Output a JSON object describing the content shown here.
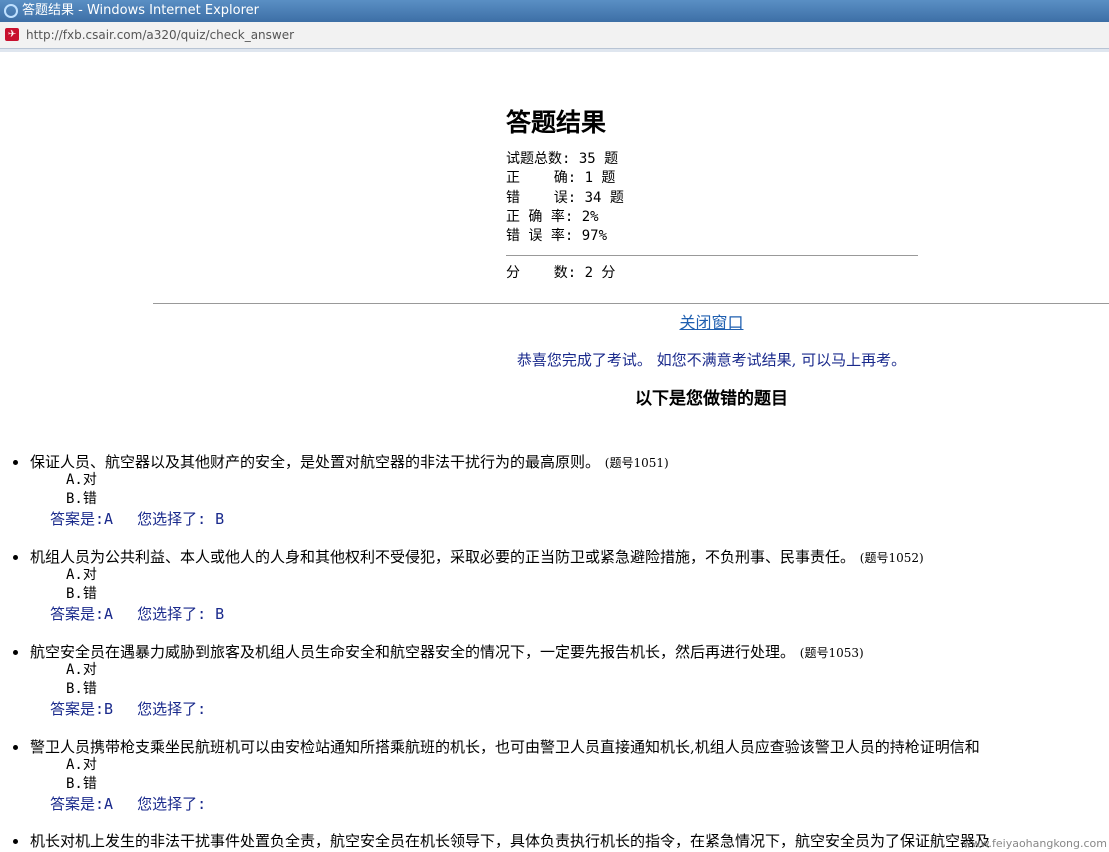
{
  "window": {
    "title": "答题结果 - Windows Internet Explorer",
    "url": "http://fxb.csair.com/a320/quiz/check_answer"
  },
  "result": {
    "heading": "答题结果",
    "lines": [
      "试题总数: 35 题",
      "正    确: 1 题",
      "错    误: 34 题",
      "正 确 率: 2%",
      "错 误 率: 97%"
    ],
    "score": "分    数: 2 分"
  },
  "links": {
    "close_window": "关闭窗口"
  },
  "messages": {
    "congrats": "恭喜您完成了考试。 如您不满意考试结果, 可以马上再考。",
    "wrong_title": "以下是您做错的题目"
  },
  "questions": [
    {
      "text": "保证人员、航空器以及其他财产的安全，是处置对航空器的非法干扰行为的最高原则。",
      "id": "(题号1051)",
      "options": [
        "A.对",
        "B.错"
      ],
      "answer": "答案是:A",
      "chosen": "您选择了: B"
    },
    {
      "text": "机组人员为公共利益、本人或他人的人身和其他权利不受侵犯，采取必要的正当防卫或紧急避险措施，不负刑事、民事责任。",
      "id": "(题号1052)",
      "options": [
        "A.对",
        "B.错"
      ],
      "answer": "答案是:A",
      "chosen": "您选择了: B"
    },
    {
      "text": "航空安全员在遇暴力威胁到旅客及机组人员生命安全和航空器安全的情况下，一定要先报告机长，然后再进行处理。",
      "id": "(题号1053)",
      "options": [
        "A.对",
        "B.错"
      ],
      "answer": "答案是:B",
      "chosen": "您选择了:"
    },
    {
      "text": "警卫人员携带枪支乘坐民航班机可以由安检站通知所搭乘航班的机长，也可由警卫人员直接通知机长,机组人员应查验该警卫人员的持枪证明信和",
      "id": "",
      "options": [
        "A.对",
        "B.错"
      ],
      "answer": "答案是:A",
      "chosen": "您选择了:"
    },
    {
      "text": "机长对机上发生的非法干扰事件处置负全责，航空安全员在机长领导下，具体负责执行机长的指令，在紧急情况下，航空安全员为了保证航空器及",
      "id": "",
      "options": [],
      "answer": "",
      "chosen": ""
    }
  ],
  "watermark": "www.feiyaohangkong.com"
}
